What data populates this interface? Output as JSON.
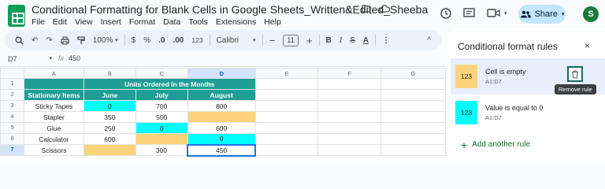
{
  "doc": {
    "title": "Conditional Formatting for Blank Cells in Google Sheets_Written&Edited_Sheeba",
    "menu": [
      "File",
      "Edit",
      "View",
      "Insert",
      "Format",
      "Data",
      "Tools",
      "Extensions",
      "Help"
    ],
    "title_icons": [
      "star-icon",
      "move-folder-icon",
      "cloud-status-icon"
    ]
  },
  "topbar": {
    "share_label": "Share",
    "avatar_initial": "S"
  },
  "toolbar": {
    "zoom": "100%",
    "currency": "$",
    "percent": "%",
    "dec_decrease": ".0",
    "dec_increase": ".00",
    "number_format": "123",
    "font": "Calibri",
    "font_size": "11",
    "minus": "−",
    "plus": "+",
    "bold": "B",
    "italic": "I",
    "strike": "S",
    "text_color": "A",
    "more": "⋮",
    "collapse": "^"
  },
  "formula_bar": {
    "cell_ref": "D7",
    "fx": "fx",
    "value": "450"
  },
  "sheet": {
    "col_headers": [
      "A",
      "B",
      "C",
      "D",
      "E",
      "F",
      "G"
    ],
    "row_numbers": [
      "1",
      "2",
      "3",
      "4",
      "5",
      "6",
      "7"
    ],
    "merged_header": "Units Ordered In the Months",
    "header_row": [
      "Stationary Items",
      "June",
      "July",
      "August"
    ],
    "rows": [
      [
        "Sticky Tapes",
        "0",
        "700",
        "800"
      ],
      [
        "Stapler",
        "350",
        "500",
        ""
      ],
      [
        "Glue",
        "250",
        "0",
        "600"
      ],
      [
        "Calculator",
        "600",
        "",
        "0"
      ],
      [
        "Scissors",
        "",
        "300",
        "450"
      ]
    ]
  },
  "panel": {
    "title": "Conditional format rules",
    "close": "×",
    "rules": [
      {
        "preview": "123",
        "name": "Cell is empty",
        "range": "A1:D7",
        "color": "#fad37a"
      },
      {
        "preview": "123",
        "name": "Value is equal to 0",
        "range": "A1:D7",
        "color": "#00ffff"
      }
    ],
    "tooltip": "Remove rule",
    "add_rule": "Add another rule"
  },
  "colors": {
    "header_teal": "#1e9e94",
    "blank_yellow": "#fad37a",
    "zero_cyan": "#00ffff",
    "selection_blue": "#1a73e8"
  }
}
